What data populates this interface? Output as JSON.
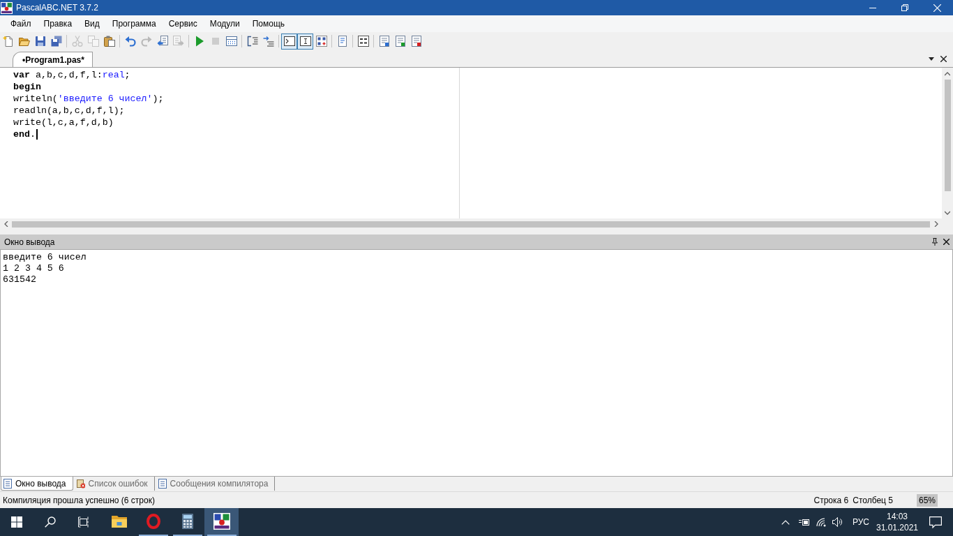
{
  "window": {
    "title": "PascalABC.NET 3.7.2"
  },
  "menu": [
    "Файл",
    "Правка",
    "Вид",
    "Программа",
    "Сервис",
    "Модули",
    "Помощь"
  ],
  "toolbar": {
    "groups": [
      [
        {
          "disabled": false,
          "pressed": false
        },
        {
          "disabled": false,
          "pressed": false
        },
        {
          "disabled": false,
          "pressed": false
        },
        {
          "disabled": false,
          "pressed": false
        }
      ],
      [
        {
          "disabled": true,
          "pressed": false
        },
        {
          "disabled": true,
          "pressed": false
        },
        {
          "disabled": false,
          "pressed": false
        }
      ],
      [
        {
          "disabled": false,
          "pressed": false
        },
        {
          "disabled": true,
          "pressed": false
        },
        {
          "disabled": false,
          "pressed": false
        },
        {
          "disabled": true,
          "pressed": false
        }
      ],
      [
        {
          "disabled": false,
          "pressed": false
        },
        {
          "disabled": true,
          "pressed": false
        },
        {
          "disabled": false,
          "pressed": false
        }
      ],
      [
        {
          "disabled": false,
          "pressed": false
        },
        {
          "disabled": false,
          "pressed": false
        }
      ],
      [
        {
          "disabled": false,
          "pressed": true
        },
        {
          "disabled": false,
          "pressed": true
        },
        {
          "disabled": false,
          "pressed": false
        }
      ],
      [
        {
          "disabled": false,
          "pressed": false
        }
      ],
      [
        {
          "disabled": false,
          "pressed": false
        }
      ],
      [
        {
          "disabled": false,
          "pressed": false
        },
        {
          "disabled": false,
          "pressed": false
        },
        {
          "disabled": false,
          "pressed": false
        }
      ]
    ]
  },
  "editor_tabs": [
    {
      "label": "•Program1.pas*",
      "selected": true
    }
  ],
  "editor": {
    "lines": [
      {
        "tokens": [
          {
            "kind": "keyword",
            "text": "var"
          },
          {
            "kind": "plain",
            "text": " a,b,c,d,f,l:"
          },
          {
            "kind": "type",
            "text": "real"
          },
          {
            "kind": "plain",
            "text": ";"
          }
        ],
        "cursor": false
      },
      {
        "tokens": [
          {
            "kind": "keyword",
            "text": "begin"
          }
        ],
        "cursor": false
      },
      {
        "tokens": [
          {
            "kind": "plain",
            "text": "writeln("
          },
          {
            "kind": "string",
            "text": "'введите 6 чисел'"
          },
          {
            "kind": "plain",
            "text": ");"
          }
        ],
        "cursor": false
      },
      {
        "tokens": [
          {
            "kind": "plain",
            "text": "readln(a,b,c,d,f,l);"
          }
        ],
        "cursor": false
      },
      {
        "tokens": [
          {
            "kind": "plain",
            "text": "write(l,c,a,f,d,b)"
          }
        ],
        "cursor": false
      },
      {
        "tokens": [
          {
            "kind": "keyword",
            "text": "end"
          },
          {
            "kind": "plain",
            "text": "."
          }
        ],
        "cursor": true
      }
    ]
  },
  "output_panel": {
    "title": "Окно вывода",
    "lines": [
      "введите 6 чисел",
      "1 2 3 4 5 6",
      "631542"
    ]
  },
  "bottom_tabs": [
    {
      "label": "Окно вывода",
      "selected": true
    },
    {
      "label": "Список ошибок",
      "selected": false
    },
    {
      "label": "Сообщения компилятора",
      "selected": false
    }
  ],
  "status_bar": {
    "message": "Компиляция прошла успешно (6 строк)",
    "line": "Строка 6",
    "column": "Столбец 5",
    "zoom": "65%"
  },
  "taskbar": {
    "apps": [
      {
        "running": false,
        "selected": false
      },
      {
        "running": true,
        "selected": false
      },
      {
        "running": true,
        "selected": false
      },
      {
        "running": true,
        "selected": true
      }
    ],
    "language": "РУС",
    "time": "14:03",
    "date": "31.01.2021"
  }
}
